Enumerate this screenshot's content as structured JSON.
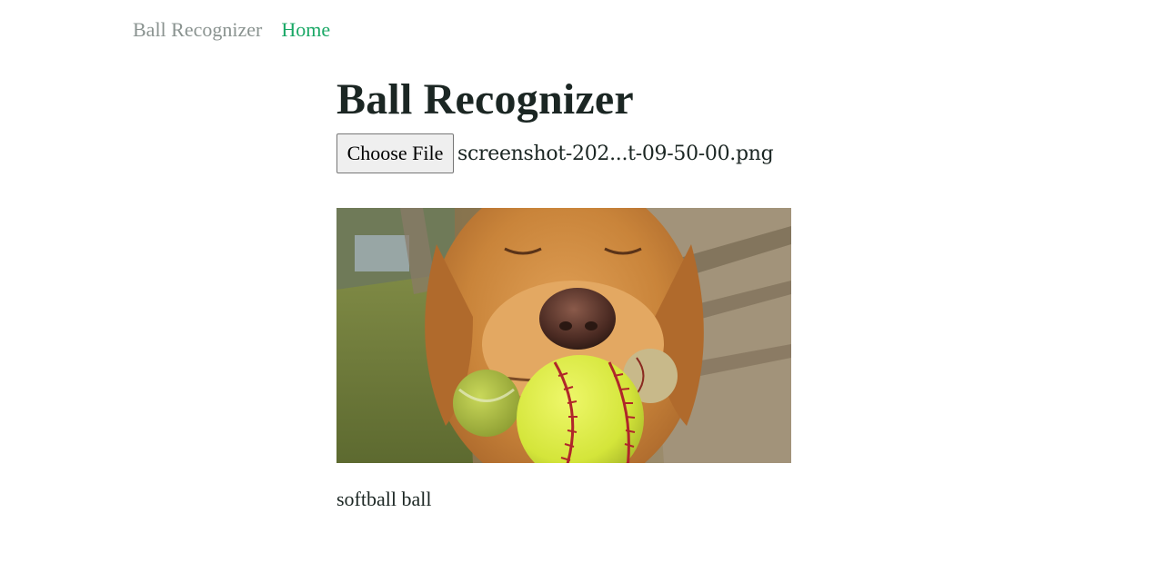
{
  "nav": {
    "brand": "Ball Recognizer",
    "home": "Home"
  },
  "main": {
    "title": "Ball Recognizer",
    "choose_file_label": "Choose File",
    "file_name": "screenshot-202...t-09-50-00.png",
    "result": "softball ball"
  },
  "colors": {
    "text": "#1b2623",
    "brand_muted": "#8a9390",
    "link_green": "#1aa866",
    "button_bg": "#efefef"
  }
}
